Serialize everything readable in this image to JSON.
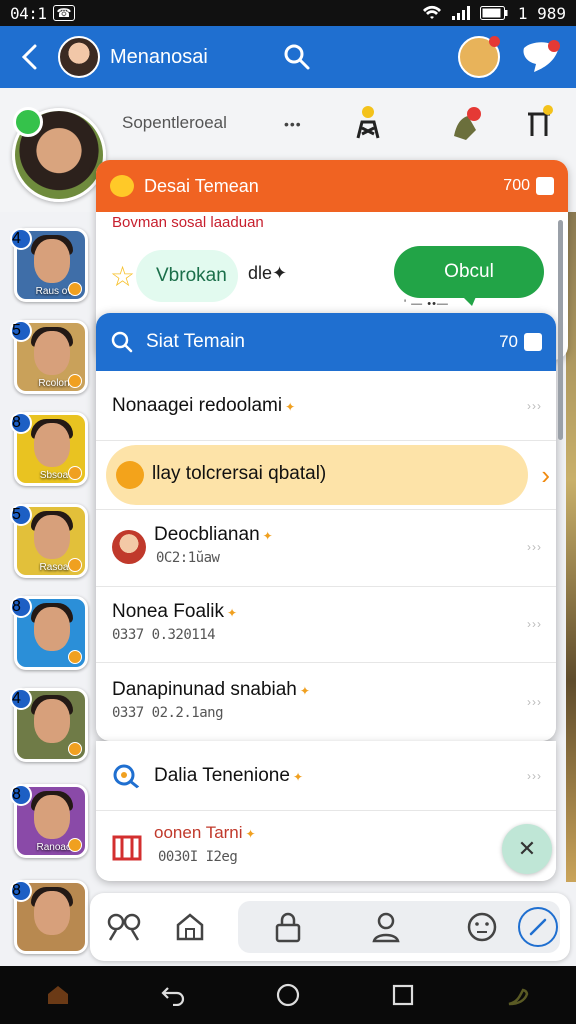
{
  "status_bar": {
    "time": "04:1",
    "sim_label": "☎",
    "clock": "1 989"
  },
  "app_bar": {
    "back_icon": "back-arrow-icon",
    "title": "Menanosai"
  },
  "profile_strip": {
    "label": "Sopentleroeal",
    "dots": "•••"
  },
  "contacts": [
    {
      "num": "4",
      "name": "Raus ov"
    },
    {
      "num": "5",
      "name": "Rcolon"
    },
    {
      "num": "8",
      "name": "Sbsoa"
    },
    {
      "num": "5",
      "name": "Rasoa"
    },
    {
      "num": "8",
      "name": ""
    },
    {
      "num": "4",
      "name": ""
    },
    {
      "num": "8",
      "name": "Ranoao"
    },
    {
      "num": "8",
      "name": ""
    }
  ],
  "orange_card": {
    "title": "Desai Temean",
    "count": "700",
    "subtitle": "Bovman sosal laaduan",
    "pill_label": "Vbrokan",
    "after_pill": "dle",
    "button_label": "Obcul",
    "tiny_text": "' — ••—"
  },
  "blue_card": {
    "title": "Siat Temain",
    "count": "70",
    "rows": [
      {
        "label": "Nonaagei redoolami",
        "meta": "",
        "chev": "›››"
      },
      {
        "label": "llay tolcrersai qbatal)",
        "meta": "",
        "chev": "›"
      },
      {
        "label": "Deocblianan",
        "meta": "0C2:1ŭaw",
        "chev": "›››"
      },
      {
        "label": "Nonea Foalik",
        "meta": "0337 0.320114",
        "chev": "›››"
      },
      {
        "label": "Danapinunad snabiah",
        "meta": "0337 02.2.1ang",
        "chev": "›››"
      }
    ]
  },
  "lower_card": {
    "rows": [
      {
        "label": "Dalia Tenenione",
        "meta": "",
        "chev": "›››"
      },
      {
        "label": "oonen Tarni",
        "meta": "0030I I2eg"
      }
    ],
    "close_label": "✕"
  },
  "colors": {
    "blue": "#1f6fd0",
    "orange": "#f06322",
    "green": "#22a447"
  }
}
